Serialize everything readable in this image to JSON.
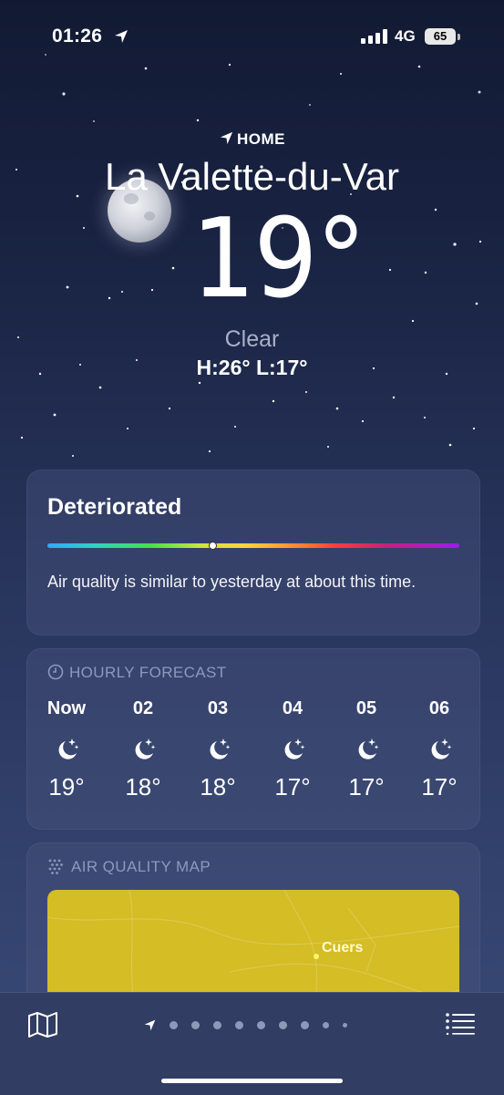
{
  "status_bar": {
    "time": "01:26",
    "network": "4G",
    "battery": "65"
  },
  "location": {
    "label": "HOME",
    "city": "La Valette-du-Var"
  },
  "current": {
    "temperature": "19°",
    "condition": "Clear",
    "high_low": "H:26°  L:17°"
  },
  "air_quality": {
    "title": "Deteriorated",
    "description": "Air quality is similar to yesterday at about this time.",
    "level_fraction": 0.4
  },
  "hourly": {
    "header": "HOURLY FORECAST",
    "items": [
      {
        "time": "Now",
        "icon": "moon-stars-icon",
        "temp": "19°"
      },
      {
        "time": "02",
        "icon": "moon-stars-icon",
        "temp": "18°"
      },
      {
        "time": "03",
        "icon": "moon-stars-icon",
        "temp": "18°"
      },
      {
        "time": "04",
        "icon": "moon-stars-icon",
        "temp": "17°"
      },
      {
        "time": "05",
        "icon": "moon-stars-icon",
        "temp": "17°"
      },
      {
        "time": "06",
        "icon": "moon-stars-icon",
        "temp": "17°"
      }
    ]
  },
  "air_quality_map": {
    "header": "AIR QUALITY MAP",
    "city_label": "Cuers",
    "color": "#d4bd25"
  },
  "bottom_bar": {
    "icons": [
      "map-icon",
      "location-arrow-icon",
      "list-icon"
    ],
    "page_count": 9
  }
}
